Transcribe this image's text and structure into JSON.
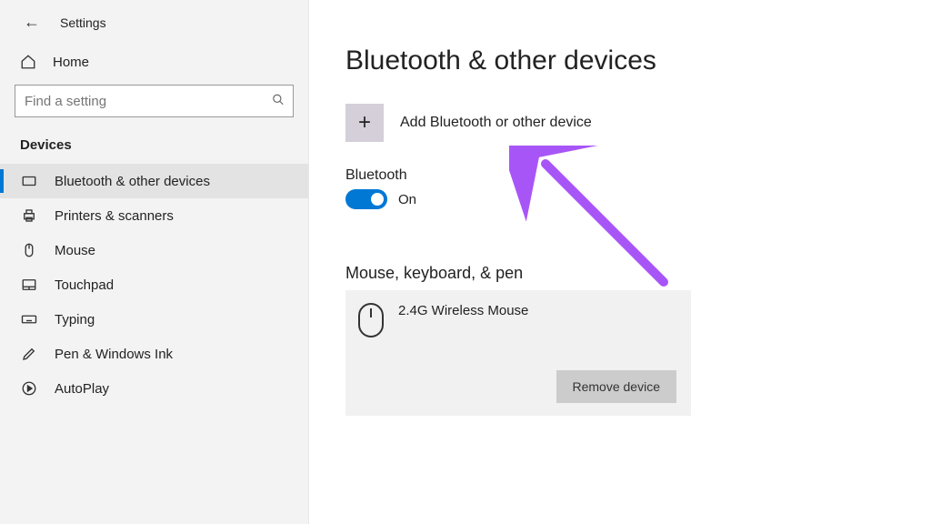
{
  "header": {
    "settings_label": "Settings"
  },
  "sidebar": {
    "home_label": "Home",
    "search_placeholder": "Find a setting",
    "category_label": "Devices",
    "items": [
      {
        "label": "Bluetooth & other devices"
      },
      {
        "label": "Printers & scanners"
      },
      {
        "label": "Mouse"
      },
      {
        "label": "Touchpad"
      },
      {
        "label": "Typing"
      },
      {
        "label": "Pen & Windows Ink"
      },
      {
        "label": "AutoPlay"
      }
    ]
  },
  "main": {
    "title": "Bluetooth & other devices",
    "add_label": "Add Bluetooth or other device",
    "bluetooth_label": "Bluetooth",
    "toggle_state": "On",
    "group_title": "Mouse, keyboard, & pen",
    "device_name": "2.4G Wireless Mouse",
    "remove_label": "Remove device"
  }
}
